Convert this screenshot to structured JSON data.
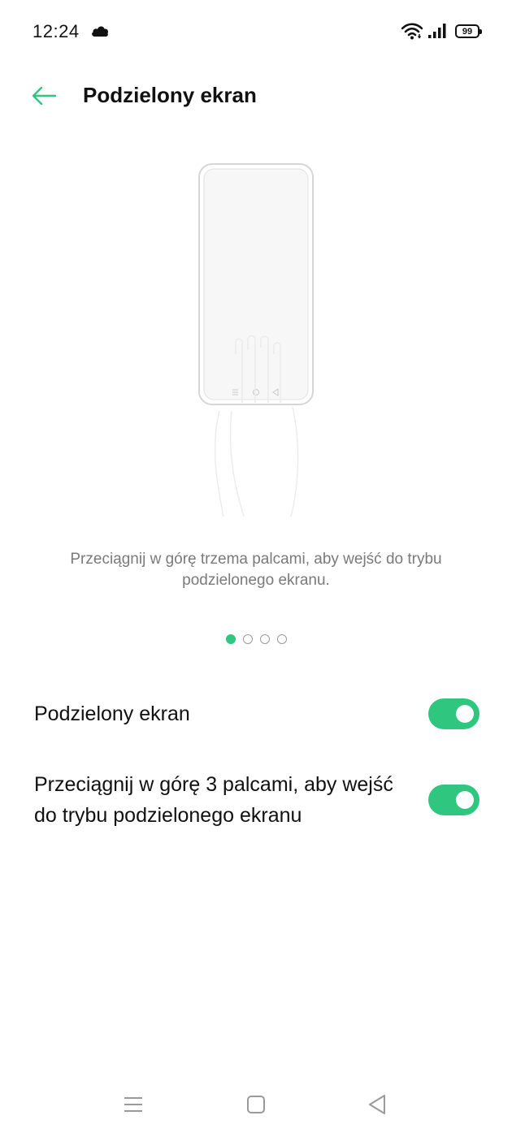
{
  "status_bar": {
    "time": "12:24",
    "battery": "99",
    "icons": [
      "cloud-icon",
      "wifi-icon",
      "signal-icon",
      "battery-icon"
    ]
  },
  "header": {
    "title": "Podzielony ekran",
    "back_icon": "arrow-left-icon"
  },
  "illustration": {
    "icons": [
      "phone-outline-icon",
      "hand-swipe-icon"
    ]
  },
  "description": "Przeciągnij w górę trzema palcami, aby wejść do trybu podzielonego ekranu.",
  "pager": {
    "total": 4,
    "active_index": 0
  },
  "settings": [
    {
      "label": "Podzielony ekran",
      "enabled": true
    },
    {
      "label": "Przeciągnij w górę 3 palcami, aby wejść do trybu podzielonego ekranu",
      "enabled": true
    }
  ],
  "colors": {
    "accent": "#2fc77f",
    "text_primary": "#111111",
    "text_secondary": "#7a7a7a"
  },
  "nav_bar": {
    "icons": [
      "menu-icon",
      "home-square-icon",
      "back-triangle-icon"
    ]
  }
}
